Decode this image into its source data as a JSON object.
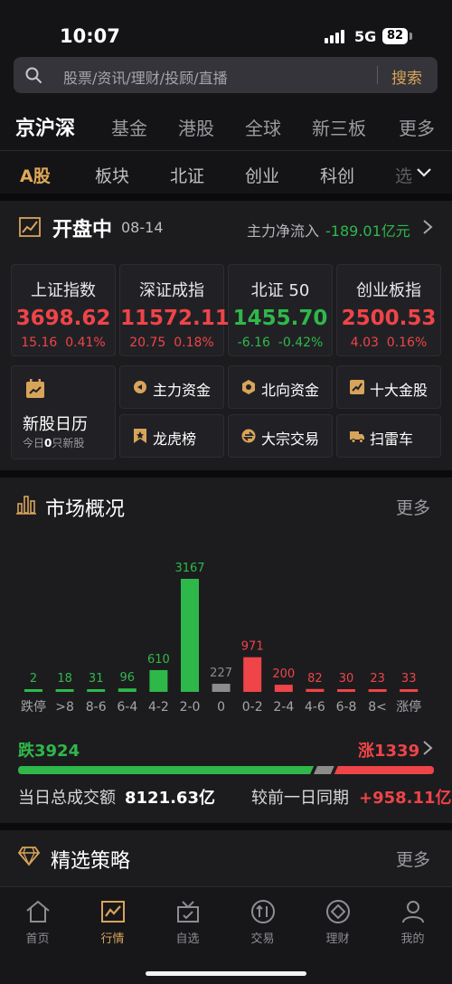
{
  "status_bar": {
    "time": "10:07",
    "network": "5G",
    "battery": "82"
  },
  "search": {
    "placeholder": "股票/资讯/理财/投顾/直播",
    "button_label": "搜索"
  },
  "market_tabs": [
    "京沪深",
    "基金",
    "港股",
    "全球",
    "新三板",
    "更多"
  ],
  "sub_tabs": [
    "A股",
    "板块",
    "北证",
    "创业",
    "科创",
    "选"
  ],
  "opening": {
    "title": "开盘中",
    "date": "08-14",
    "flow_label": "主力净流入",
    "flow_value": "-189.01亿元"
  },
  "indices": [
    {
      "name": "上证指数",
      "value": "3698.62",
      "change": "15.16",
      "pct": "0.41%",
      "direction": "up"
    },
    {
      "name": "深证成指",
      "value": "11572.11",
      "change": "20.75",
      "pct": "0.18%",
      "direction": "up"
    },
    {
      "name": "北证 50",
      "value": "1455.70",
      "change": "-6.16",
      "pct": "-0.42%",
      "direction": "down"
    },
    {
      "name": "创业板指",
      "value": "2500.53",
      "change": "4.03",
      "pct": "0.16%",
      "direction": "up"
    }
  ],
  "ipo_calendar": {
    "title": "新股日历",
    "sub_prefix": "今日",
    "count": "0",
    "sub_suffix": "只新股"
  },
  "functions": [
    {
      "label": "主力资金",
      "icon": "coin-icon"
    },
    {
      "label": "北向资金",
      "icon": "compass-icon"
    },
    {
      "label": "十大金股",
      "icon": "chart-up-icon"
    },
    {
      "label": "龙虎榜",
      "icon": "bookmark-icon"
    },
    {
      "label": "大宗交易",
      "icon": "exchange-icon"
    },
    {
      "label": "扫雷车",
      "icon": "truck-icon"
    }
  ],
  "overview": {
    "title": "市场概况",
    "more": "更多"
  },
  "chart_data": {
    "type": "bar",
    "categories": [
      "跌停",
      ">8",
      "8-6",
      "6-4",
      "4-2",
      "2-0",
      "0",
      "0-2",
      "2-4",
      "4-6",
      "6-8",
      "8<",
      "涨停"
    ],
    "values": [
      2,
      18,
      31,
      96,
      610,
      3167,
      227,
      971,
      200,
      82,
      30,
      23,
      33
    ],
    "colors": [
      "#2fb84a",
      "#2fb84a",
      "#2fb84a",
      "#2fb84a",
      "#2fb84a",
      "#2fb84a",
      "#8c8c8c",
      "#ef4448",
      "#ef4448",
      "#ef4448",
      "#ef4448",
      "#ef4448",
      "#ef4448"
    ],
    "ylim": [
      0,
      3167
    ]
  },
  "breadth": {
    "down_label": "跌3924",
    "up_label": "涨1339",
    "down_count": 3924,
    "flat_count": 227,
    "up_count": 1339,
    "turnover_label": "当日总成交额",
    "turnover_value": "8121.63亿",
    "compare_label": "较前一日同期",
    "compare_value": "+958.11亿"
  },
  "strategy": {
    "title": "精选策略",
    "more": "更多"
  },
  "bottom_nav": [
    {
      "label": "首页",
      "icon": "home-icon"
    },
    {
      "label": "行情",
      "icon": "market-chart-icon"
    },
    {
      "label": "自选",
      "icon": "watchlist-icon"
    },
    {
      "label": "交易",
      "icon": "trade-icon"
    },
    {
      "label": "理财",
      "icon": "wealth-icon"
    },
    {
      "label": "我的",
      "icon": "profile-icon"
    }
  ],
  "colors": {
    "accent": "#d8a45a",
    "up": "#ef4448",
    "down": "#2fb84a",
    "flat": "#8c8c8c",
    "background": "#141416"
  }
}
